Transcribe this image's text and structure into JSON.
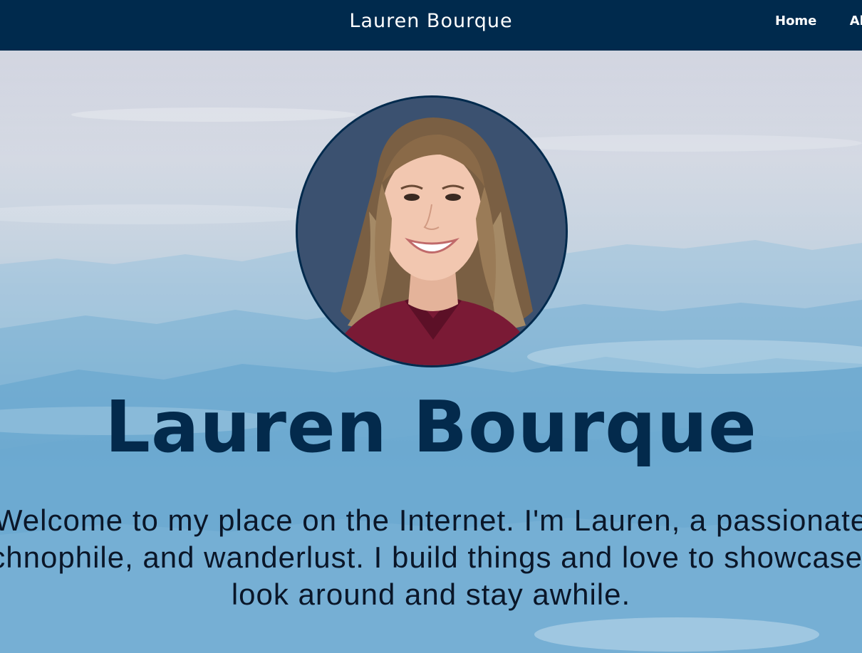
{
  "navbar": {
    "brand": "Lauren Bourque",
    "links": [
      "Home",
      "Ab"
    ]
  },
  "hero": {
    "title": "Lauren Bourque",
    "intro_lines": [
      "Welcome to my place on the Internet. I'm Lauren, a passionate",
      "technophile, and wanderlust. I build things and love to showcase th",
      "look around and stay awhile."
    ]
  },
  "colors": {
    "navbar_bg": "#002a4d",
    "title": "#032a4c",
    "shirt": "#7a1a35"
  },
  "icons": {
    "avatar": "profile-photo"
  }
}
